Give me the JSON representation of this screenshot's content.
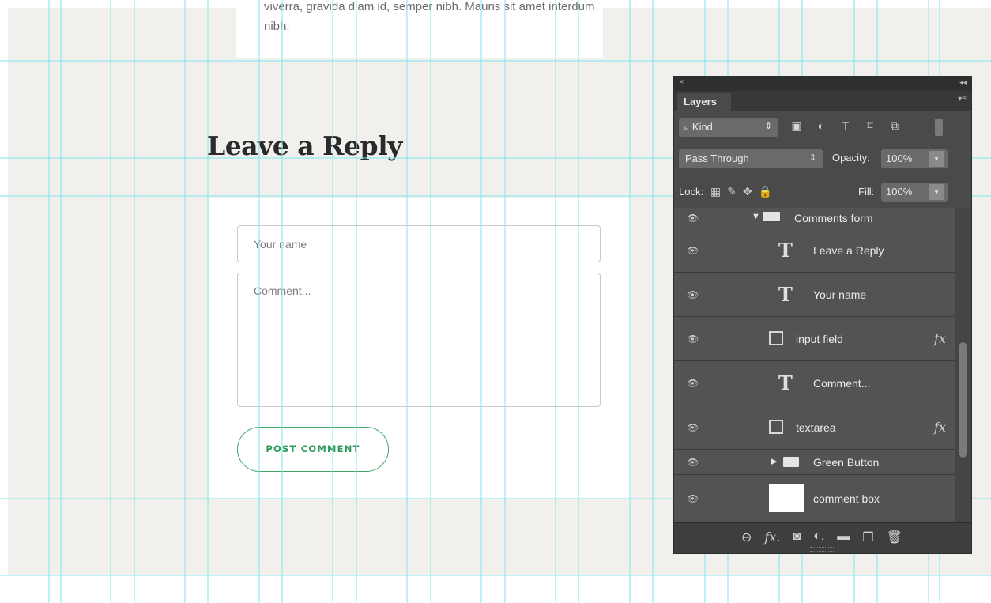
{
  "page": {
    "top_text": "viverra, gravida diam id, semper nibh. Mauris sit amet interdum nibh.",
    "heading": "Leave a Reply",
    "name_placeholder": "Your name",
    "comment_placeholder": "Comment...",
    "post_button": "POST COMMENT",
    "accent_color": "#3fa46a"
  },
  "layers_panel": {
    "close_glyph": "×",
    "collapse_glyph": "◂◂",
    "tab": "Layers",
    "tab_menu_glyph": "▾≡",
    "filter_select": "⌕ Kind",
    "select_arrow": "⇕",
    "filter_icons": [
      "image-filter-icon",
      "adjustment-filter-icon",
      "type-filter-icon",
      "shape-filter-icon",
      "smart-object-filter-icon"
    ],
    "filter_glyphs": [
      "▣",
      "◐",
      "T",
      "⌑",
      "⧉"
    ],
    "blend_mode": "Pass Through",
    "opacity_label": "Opacity:",
    "opacity_value": "100%",
    "lock_label": "Lock:",
    "lock_glyphs": [
      "▦",
      "✎",
      "✥",
      "🔒"
    ],
    "fill_label": "Fill:",
    "fill_value": "100%",
    "dropdown_glyph": "▾",
    "eye_glyph": "👁",
    "type_glyph": "T",
    "fx_glyph": "fx",
    "layers": {
      "group": {
        "name": "Comments form",
        "disclosure": "▼"
      },
      "l1": {
        "name": "Leave a Reply"
      },
      "l2": {
        "name": "Your name"
      },
      "l3": {
        "name": "input field"
      },
      "l4": {
        "name": "Comment..."
      },
      "l5": {
        "name": "textarea"
      },
      "l6": {
        "name": "Green Button",
        "disclosure": "▶"
      },
      "l7": {
        "name": "comment box"
      }
    },
    "bottom_icons": [
      "link-icon",
      "fx-icon",
      "mask-icon",
      "adjustment-icon",
      "folder-icon",
      "new-layer-icon",
      "trash-icon"
    ],
    "bottom_glyphs": [
      "⊖",
      "fx.",
      "◙",
      "◐.",
      "▬",
      "❐",
      "🗑"
    ]
  }
}
